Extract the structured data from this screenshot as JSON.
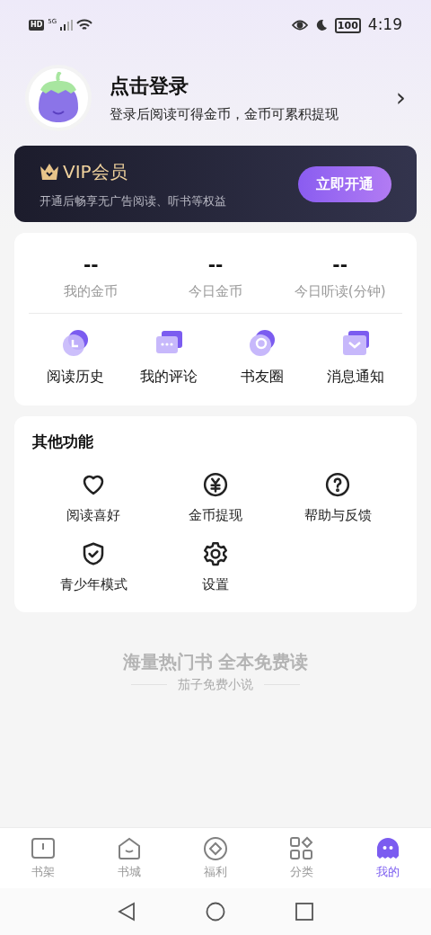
{
  "status_bar": {
    "time": "4:19",
    "battery": "100",
    "network": "5G",
    "hd": "HD"
  },
  "profile": {
    "title": "点击登录",
    "subtitle": "登录后阅读可得金币，金币可累积提现",
    "chevron": "›"
  },
  "vip": {
    "title": "VIP会员",
    "subtitle": "开通后畅享无广告阅读、听书等权益",
    "button": "立即开通"
  },
  "stats": [
    {
      "value": "--",
      "label": "我的金币"
    },
    {
      "value": "--",
      "label": "今日金币"
    },
    {
      "value": "--",
      "label": "今日听读(分钟)"
    }
  ],
  "shortcuts": [
    {
      "kind": "history",
      "label": "阅读历史"
    },
    {
      "kind": "comment",
      "label": "我的评论"
    },
    {
      "kind": "circle",
      "label": "书友圈"
    },
    {
      "kind": "message",
      "label": "消息通知"
    }
  ],
  "other": {
    "title": "其他功能",
    "items": [
      {
        "kind": "heart",
        "label": "阅读喜好"
      },
      {
        "kind": "coin",
        "label": "金币提现"
      },
      {
        "kind": "help",
        "label": "帮助与反馈"
      },
      {
        "kind": "shield",
        "label": "青少年模式"
      },
      {
        "kind": "gear",
        "label": "设置"
      }
    ]
  },
  "slogan": {
    "main": "海量热门书 全本免费读",
    "sub": "茄子免费小说"
  },
  "tabs": [
    {
      "kind": "shelf",
      "label": "书架",
      "selected": false
    },
    {
      "kind": "store",
      "label": "书城",
      "selected": false
    },
    {
      "kind": "welfare",
      "label": "福利",
      "selected": false
    },
    {
      "kind": "category",
      "label": "分类",
      "selected": false
    },
    {
      "kind": "mine",
      "label": "我的",
      "selected": true
    }
  ]
}
